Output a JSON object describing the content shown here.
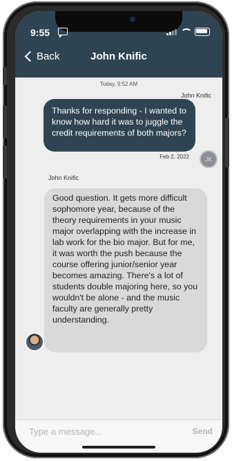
{
  "status": {
    "time": "9:55"
  },
  "nav": {
    "back_label": "Back",
    "title": "John Knific"
  },
  "chat": {
    "timestamp": "Today, 9:52 AM",
    "messages": [
      {
        "sender": "John Knific",
        "text": "Thanks for responding - I wanted to know how hard it was to juggle the credit requirements of both majors?",
        "date": "Feb 2, 2022",
        "avatar_initials": "JK"
      },
      {
        "sender": "John Knific",
        "text": "Good question. It gets more difficult sophomore year, because of the theory requirements in your music major overlapping with the increase in lab work for the bio major. But for me, it was worth the push because the course offering junior/senior year becomes amazing. There's a lot of students double majoring here, so you wouldn't be alone - and the music faculty are generally pretty understanding."
      }
    ]
  },
  "composer": {
    "placeholder": "Type a message...",
    "send_label": "Send"
  },
  "colors": {
    "header": "#2f4452",
    "outgoing_bubble": "#2f4452",
    "incoming_bubble": "#d9d9d9",
    "background": "#eeeeee"
  },
  "icons": [
    "chevron-left-icon",
    "message-icon",
    "signal-icon",
    "wifi-icon",
    "battery-icon"
  ]
}
